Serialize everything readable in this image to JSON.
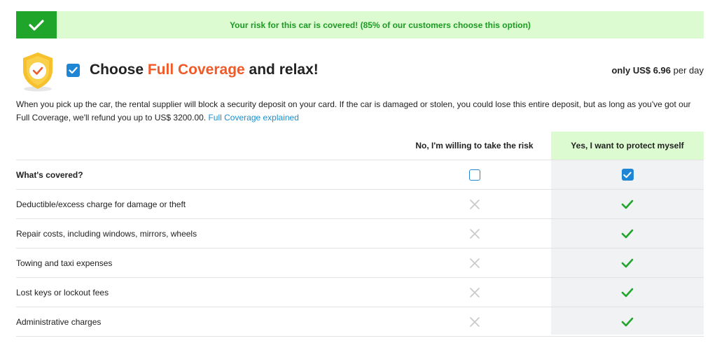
{
  "banner": {
    "text": "Your risk for this car is covered! (85% of our customers choose this option)",
    "icon": "check-icon",
    "bg_color": "#dcfbd0",
    "accent_color": "#1fa52a"
  },
  "header": {
    "title_prefix": "Choose ",
    "title_accent": "Full Coverage",
    "title_suffix": " and relax!",
    "accent_color": "#f05a28",
    "checkbox_checked": true,
    "price_prefix": "only ",
    "price_amount": "US$ 6.96",
    "price_suffix": " per day",
    "icon": "shield-check-icon"
  },
  "description": {
    "text": "When you pick up the car, the rental supplier will block a security deposit on your card. If the car is damaged or stolen, you could lose this entire deposit, but as long as you've got our Full Coverage, we'll refund you up to US$ 3200.00.",
    "link_text": "Full Coverage explained",
    "link_color": "#1a8fcf"
  },
  "table": {
    "col_no": "No, I'm willing to take the risk",
    "col_yes": "Yes, I want to protect myself",
    "header_row": "What's covered?",
    "rows": [
      {
        "label": "Deductible/excess charge for damage or theft"
      },
      {
        "label": "Repair costs, including windows, mirrors, wheels"
      },
      {
        "label": "Towing and taxi expenses"
      },
      {
        "label": "Lost keys or lockout fees"
      },
      {
        "label": "Administrative charges"
      }
    ],
    "no_icon": "x-icon",
    "yes_icon": "check-icon",
    "check_color": "#1fa52a",
    "cross_color": "#c8c8c8"
  }
}
